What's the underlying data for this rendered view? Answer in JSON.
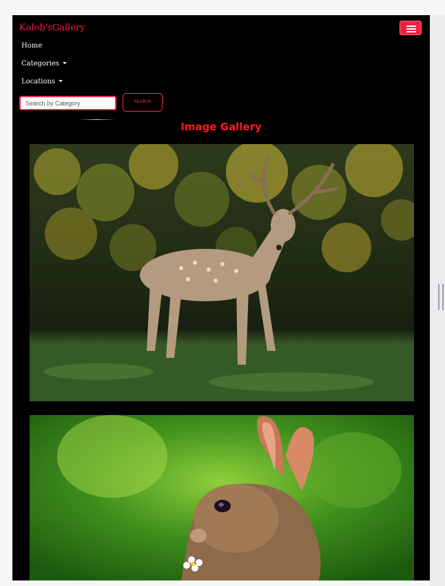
{
  "navbar": {
    "brand": "Kaleb'sGallery",
    "toggler_icon": "hamburger-icon",
    "links": [
      {
        "label": "Home"
      },
      {
        "label": "Categories",
        "dropdown": true
      },
      {
        "label": "Locations",
        "dropdown": true
      }
    ]
  },
  "search": {
    "placeholder": "Search by Category",
    "value": "",
    "button_label": "SEARCH"
  },
  "gallery": {
    "title": "Image Gallery",
    "images": [
      {
        "subject": "deer"
      },
      {
        "subject": "rabbit"
      }
    ]
  },
  "colors": {
    "accent": "#ff1a3d",
    "background": "#000000",
    "title": "#ff1a1a"
  }
}
